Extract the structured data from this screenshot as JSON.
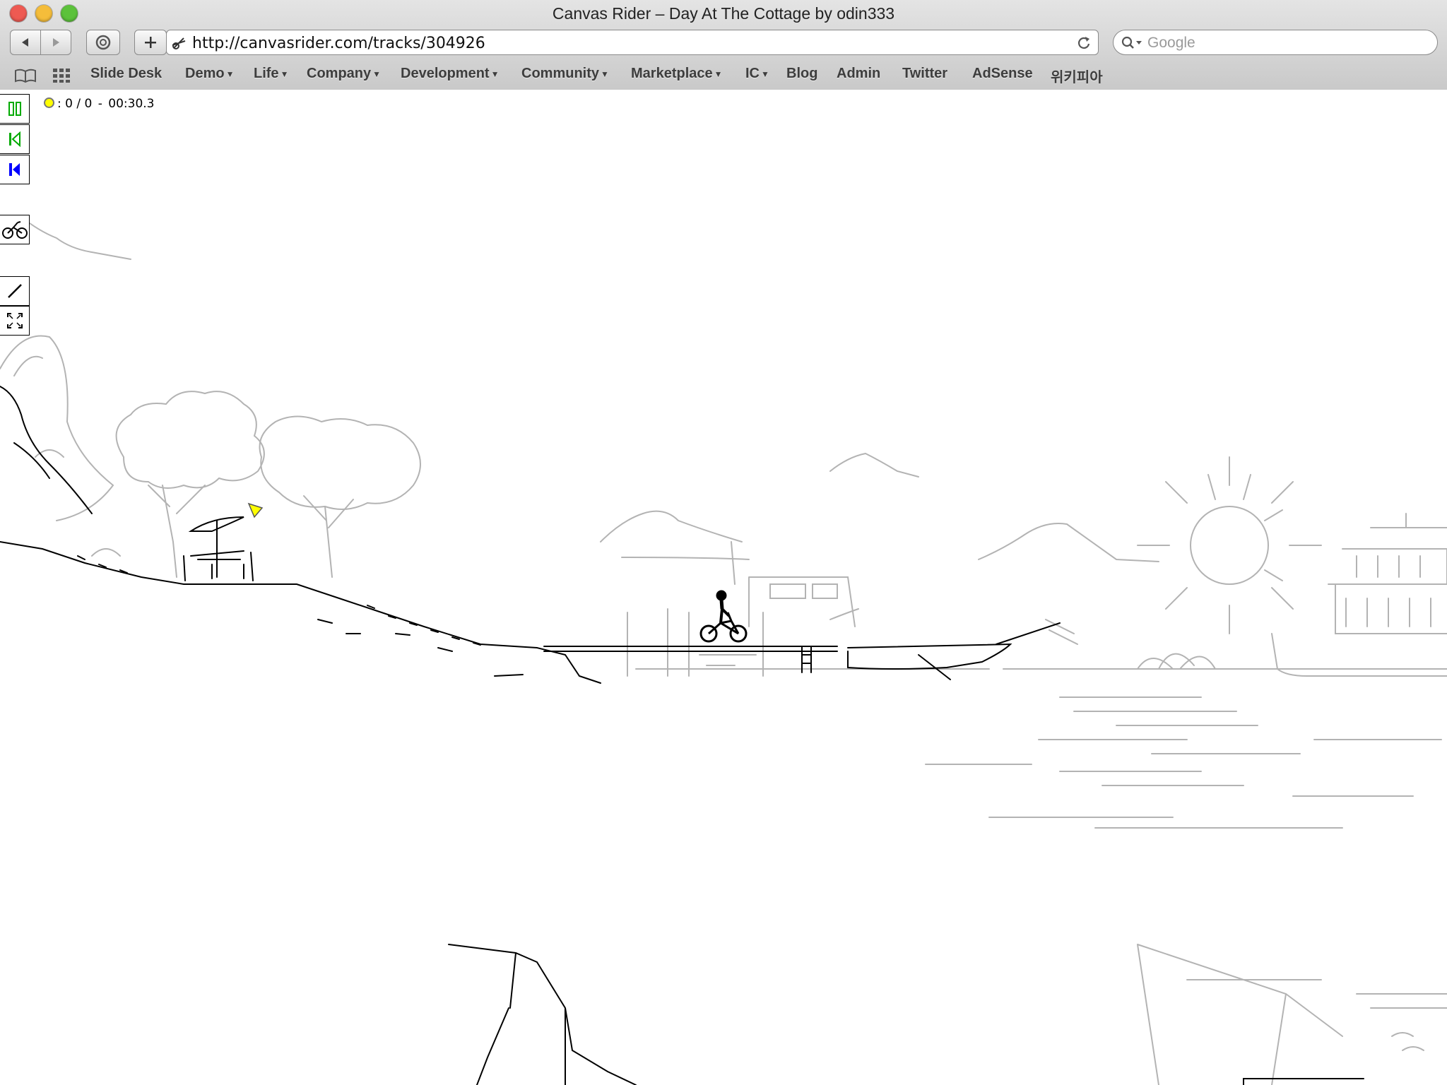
{
  "window": {
    "title": "Canvas Rider – Day At The Cottage by odin333",
    "traffic_lights": {
      "close": "#ee5a52",
      "minimize": "#f5bd3a",
      "zoom": "#5cc23b"
    }
  },
  "toolbar": {
    "back_icon": "back-arrow-icon",
    "forward_icon": "forward-arrow-icon",
    "history_icon": "history-icon",
    "add_icon": "plus-icon",
    "url": "http://canvasrider.com/tracks/304926",
    "reload_icon": "reload-icon",
    "search_placeholder": "Google"
  },
  "bookmarks": [
    {
      "label": "Slide Desk",
      "menu": false
    },
    {
      "label": "Demo",
      "menu": true
    },
    {
      "label": "Life",
      "menu": true
    },
    {
      "label": "Company",
      "menu": true
    },
    {
      "label": "Development",
      "menu": true
    },
    {
      "label": "Community",
      "menu": true
    },
    {
      "label": "Marketplace",
      "menu": true
    },
    {
      "label": "IC",
      "menu": true
    },
    {
      "label": "Blog",
      "menu": false
    },
    {
      "label": "Admin",
      "menu": false
    },
    {
      "label": "Twitter",
      "menu": false
    },
    {
      "label": "AdSense",
      "menu": false
    },
    {
      "label": "위키피아",
      "menu": false
    }
  ],
  "hud": {
    "stars_label": ": 0 / 0",
    "separator": "-",
    "time": "00:30.3",
    "star_color": "#ffff00"
  },
  "tools": [
    {
      "name": "pause",
      "icon": "pause-icon",
      "color": "#00aa00"
    },
    {
      "name": "restart",
      "icon": "restart-icon",
      "color": "#00aa00"
    },
    {
      "name": "checkpoint",
      "icon": "checkpoint-icon",
      "color": "#0000ff"
    },
    {
      "name": "bike",
      "icon": "bike-icon",
      "color": "#000000"
    },
    {
      "name": "line",
      "icon": "line-tool-icon",
      "color": "#000000"
    },
    {
      "name": "fullscreen",
      "icon": "fullscreen-icon",
      "color": "#000000"
    }
  ]
}
